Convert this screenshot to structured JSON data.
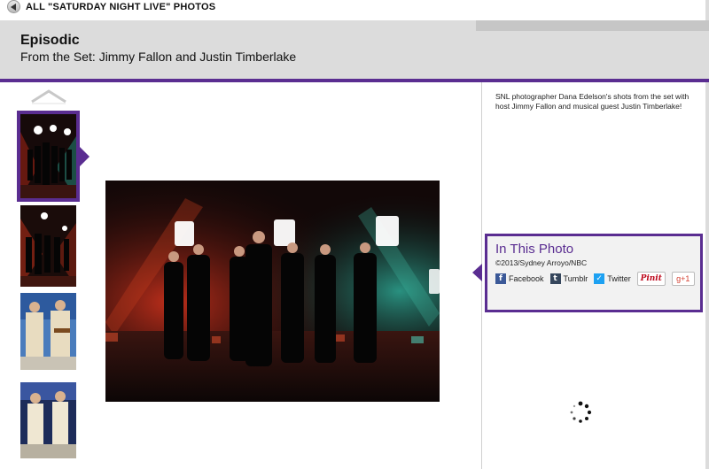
{
  "nav": {
    "back_label": "ALL \"SATURDAY NIGHT LIVE\" PHOTOS"
  },
  "header": {
    "title": "Episodic",
    "subtitle": "From the Set: Jimmy Fallon and Justin Timberlake"
  },
  "thumbnails": [
    {
      "selected": true
    },
    {
      "selected": false
    },
    {
      "selected": false
    },
    {
      "selected": false
    }
  ],
  "caption": "SNL photographer Dana Edelson's shots from the set with host Jimmy Fallon and musical guest Justin Timberlake!",
  "info": {
    "title": "In This Photo",
    "credit": "©2013/Sydney Arroyo/NBC"
  },
  "share": {
    "facebook": "Facebook",
    "tumblr": "Tumblr",
    "twitter": "Twitter",
    "pinterest": "Pinit",
    "gplus": "g+1"
  },
  "colors": {
    "accent": "#5a2d91",
    "header_bg": "#dcdcdc",
    "facebook": "#3b5998",
    "tumblr": "#35465c",
    "twitter": "#1da1f2"
  }
}
